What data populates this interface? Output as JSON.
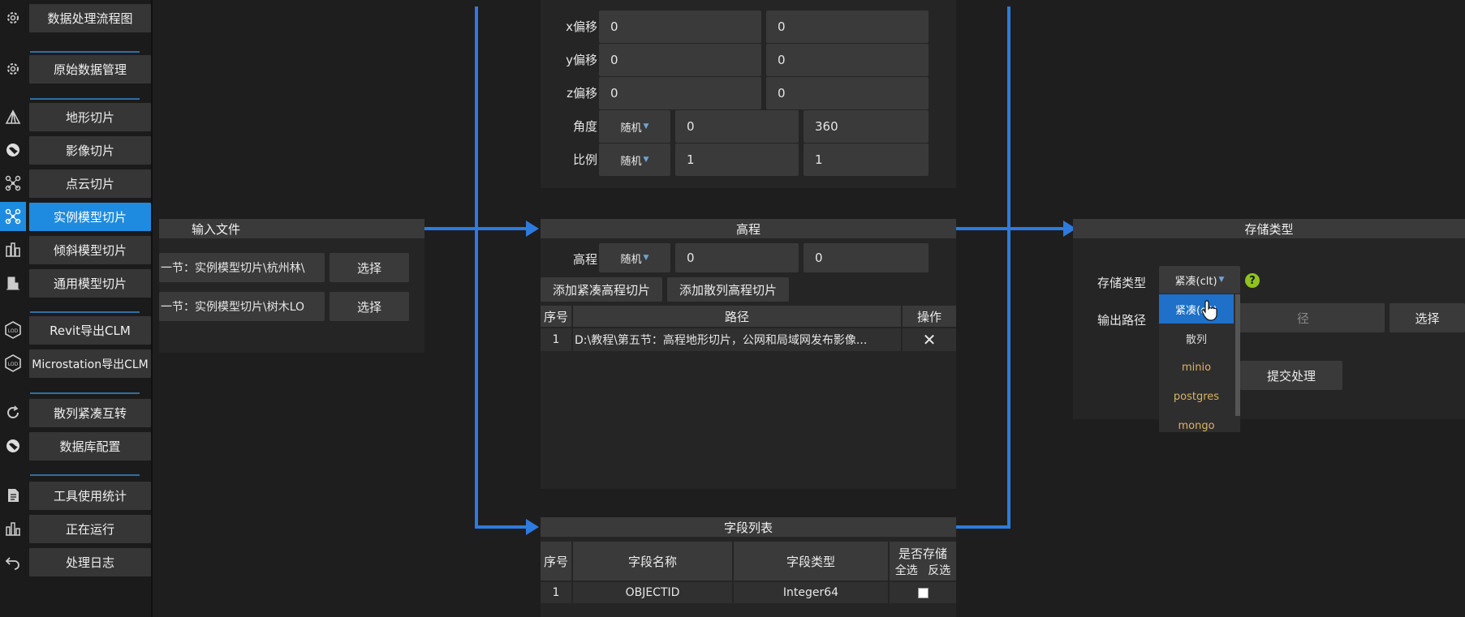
{
  "sidebar": {
    "items": [
      {
        "label": "数据处理流程图",
        "icon": "gear-icon",
        "active": false
      },
      {
        "label": "原始数据管理",
        "icon": "gear-icon",
        "active": false
      },
      {
        "label": "地形切片",
        "icon": "mountain-icon",
        "active": false
      },
      {
        "label": "影像切片",
        "icon": "globe-icon",
        "active": false
      },
      {
        "label": "点云切片",
        "icon": "network-icon",
        "active": false
      },
      {
        "label": "实例模型切片",
        "icon": "network-icon",
        "active": true
      },
      {
        "label": "倾斜模型切片",
        "icon": "buildings-icon",
        "active": false
      },
      {
        "label": "通用模型切片",
        "icon": "building-icon",
        "active": false
      },
      {
        "label": "Revit导出CLM",
        "icon": "hexagon-icon",
        "active": false
      },
      {
        "label": "Microstation导出CLM",
        "icon": "hexagon-icon",
        "active": false
      },
      {
        "label": "散列紧凑互转",
        "icon": "refresh-icon",
        "active": false
      },
      {
        "label": "数据库配置",
        "icon": "globe-icon",
        "active": false
      },
      {
        "label": "工具使用统计",
        "icon": "document-icon",
        "active": false
      },
      {
        "label": "正在运行",
        "icon": "chart-icon",
        "active": false
      },
      {
        "label": "处理日志",
        "icon": "undo-icon",
        "active": false
      }
    ]
  },
  "input_panel": {
    "title": "输入文件",
    "files": [
      {
        "path": "一节：实例模型切片\\杭州林\\",
        "button": "选择"
      },
      {
        "path": "一节：实例模型切片\\树木LO",
        "button": "选择"
      }
    ]
  },
  "offset_panel": {
    "rows": [
      {
        "label": "x偏移",
        "v1": "0",
        "v2": "0"
      },
      {
        "label": "y偏移",
        "v1": "0",
        "v2": "0"
      },
      {
        "label": "z偏移",
        "v1": "0",
        "v2": "0"
      }
    ],
    "angle": {
      "label": "角度",
      "mode": "随机",
      "min": "0",
      "max": "360"
    },
    "scale": {
      "label": "比例",
      "mode": "随机",
      "min": "1",
      "max": "1"
    }
  },
  "elevation_panel": {
    "title": "高程",
    "row": {
      "label": "高程",
      "mode": "随机",
      "v1": "0",
      "v2": "0"
    },
    "add_compact": "添加紧凑高程切片",
    "add_scatter": "添加散列高程切片",
    "headers": [
      "序号",
      "路径",
      "操作"
    ],
    "rows": [
      {
        "index": "1",
        "path": "D:\\教程\\第五节：高程地形切片，公网和局域网发布影像...",
        "action": "✕"
      }
    ]
  },
  "fields_panel": {
    "title": "字段列表",
    "headers": {
      "index": "序号",
      "name": "字段名称",
      "type": "字段类型",
      "store": "是否存储",
      "select_all": "全选",
      "invert": "反选"
    },
    "rows": [
      {
        "index": "1",
        "name": "OBJECTID",
        "type": "Integer64",
        "checked": false
      }
    ]
  },
  "storage_panel": {
    "title": "存储类型",
    "type_label": "存储类型",
    "type_value": "紧凑(clt)",
    "output_label": "输出路径",
    "output_placeholder": "径",
    "choose_button": "选择",
    "submit_button": "提交处理",
    "help_icon": "?",
    "dropdown": {
      "options": [
        "紧凑(clt)",
        "散列",
        "minio",
        "postgres",
        "mongo"
      ],
      "selected": "紧凑(clt)"
    }
  },
  "colors": {
    "accent": "#1e8be0",
    "arrow": "#2d7be0",
    "help": "#8fc31f",
    "db_option": "#d9b466"
  }
}
